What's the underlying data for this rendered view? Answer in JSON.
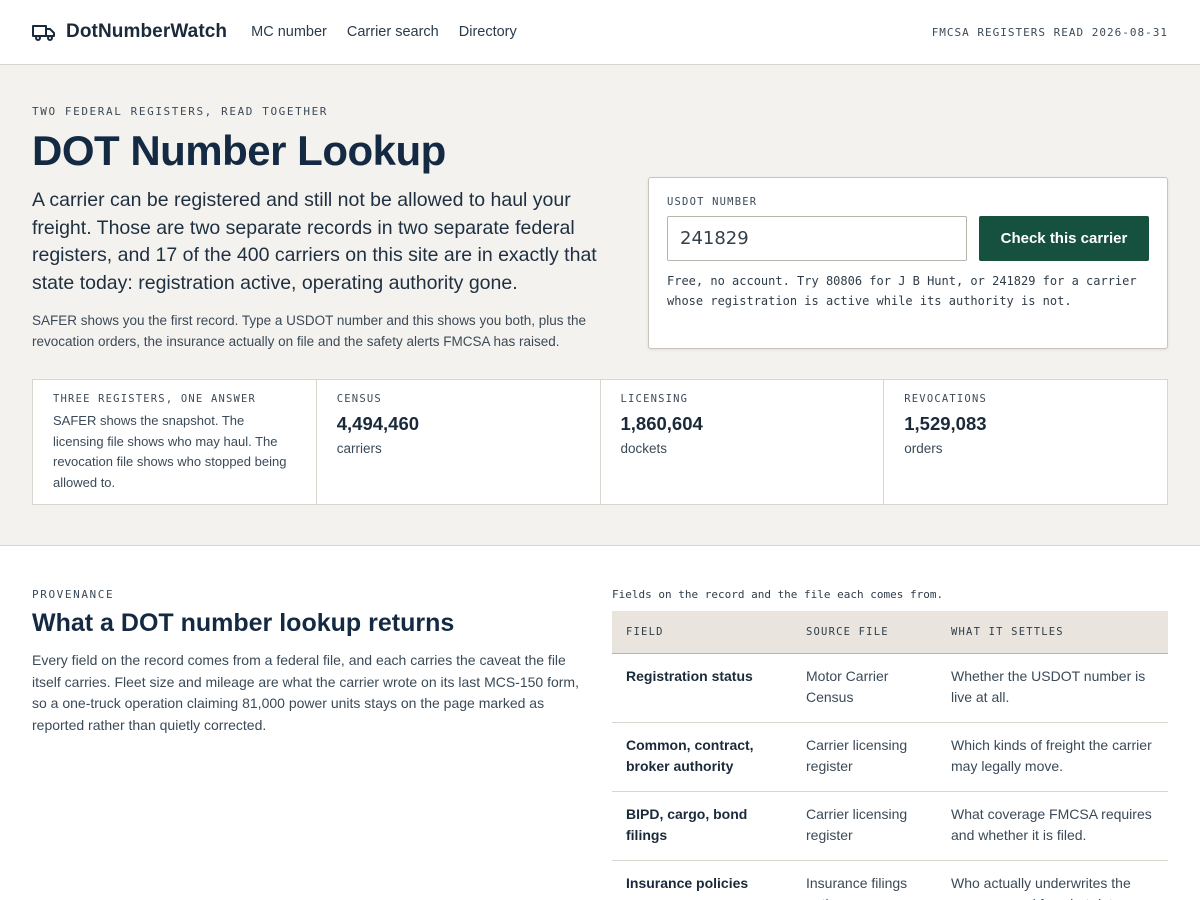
{
  "header": {
    "brand": "DotNumberWatch",
    "nav": [
      "MC number",
      "Carrier search",
      "Directory"
    ],
    "register_read": "FMCSA REGISTERS READ 2026-08-31"
  },
  "hero": {
    "eyebrow": "TWO FEDERAL REGISTERS, READ TOGETHER",
    "title": "DOT Number Lookup",
    "lead": "A carrier can be registered and still not be allowed to haul your freight. Those are two separate records in two separate federal registers, and 17 of the 400 carriers on this site are in exactly that state today: registration active, operating authority gone.",
    "sub": "SAFER shows you the first record. Type a USDOT number and this shows you both, plus the revocation orders, the insurance actually on file and the safety alerts FMCSA has raised."
  },
  "lookup": {
    "label": "USDOT NUMBER",
    "value": "241829",
    "button": "Check this carrier",
    "hint": "Free, no account. Try 80806 for J B Hunt, or 241829 for a carrier whose registration is active while its authority is not."
  },
  "stats": {
    "intro_label": "THREE REGISTERS, ONE ANSWER",
    "intro_text": "SAFER shows the snapshot. The licensing file shows who may haul. The revocation file shows who stopped being allowed to.",
    "items": [
      {
        "label": "CENSUS",
        "value": "4,494,460",
        "unit": "carriers"
      },
      {
        "label": "LICENSING",
        "value": "1,860,604",
        "unit": "dockets"
      },
      {
        "label": "REVOCATIONS",
        "value": "1,529,083",
        "unit": "orders"
      }
    ]
  },
  "provenance": {
    "eyebrow": "PROVENANCE",
    "title": "What a DOT number lookup returns",
    "body": "Every field on the record comes from a federal file, and each carries the caveat the file itself carries. Fleet size and mileage are what the carrier wrote on its last MCS-150 form, so a one-truck operation claiming 81,000 power units stays on the page marked as reported rather than quietly corrected.",
    "caption": "Fields on the record and the file each comes from.",
    "headers": [
      "FIELD",
      "SOURCE FILE",
      "WHAT IT SETTLES"
    ],
    "rows": [
      {
        "field": "Registration status",
        "source": "Motor Carrier Census",
        "settles": "Whether the USDOT number is live at all."
      },
      {
        "field": "Common, contract, broker authority",
        "source": "Carrier licensing register",
        "settles": "Which kinds of freight the carrier may legally move."
      },
      {
        "field": "BIPD, cargo, bond filings",
        "source": "Carrier licensing register",
        "settles": "What coverage FMCSA requires and whether it is filed."
      },
      {
        "field": "Insurance policies",
        "source": "Insurance filings notices",
        "settles": "Who actually underwrites the coverage and for what dates."
      }
    ]
  }
}
